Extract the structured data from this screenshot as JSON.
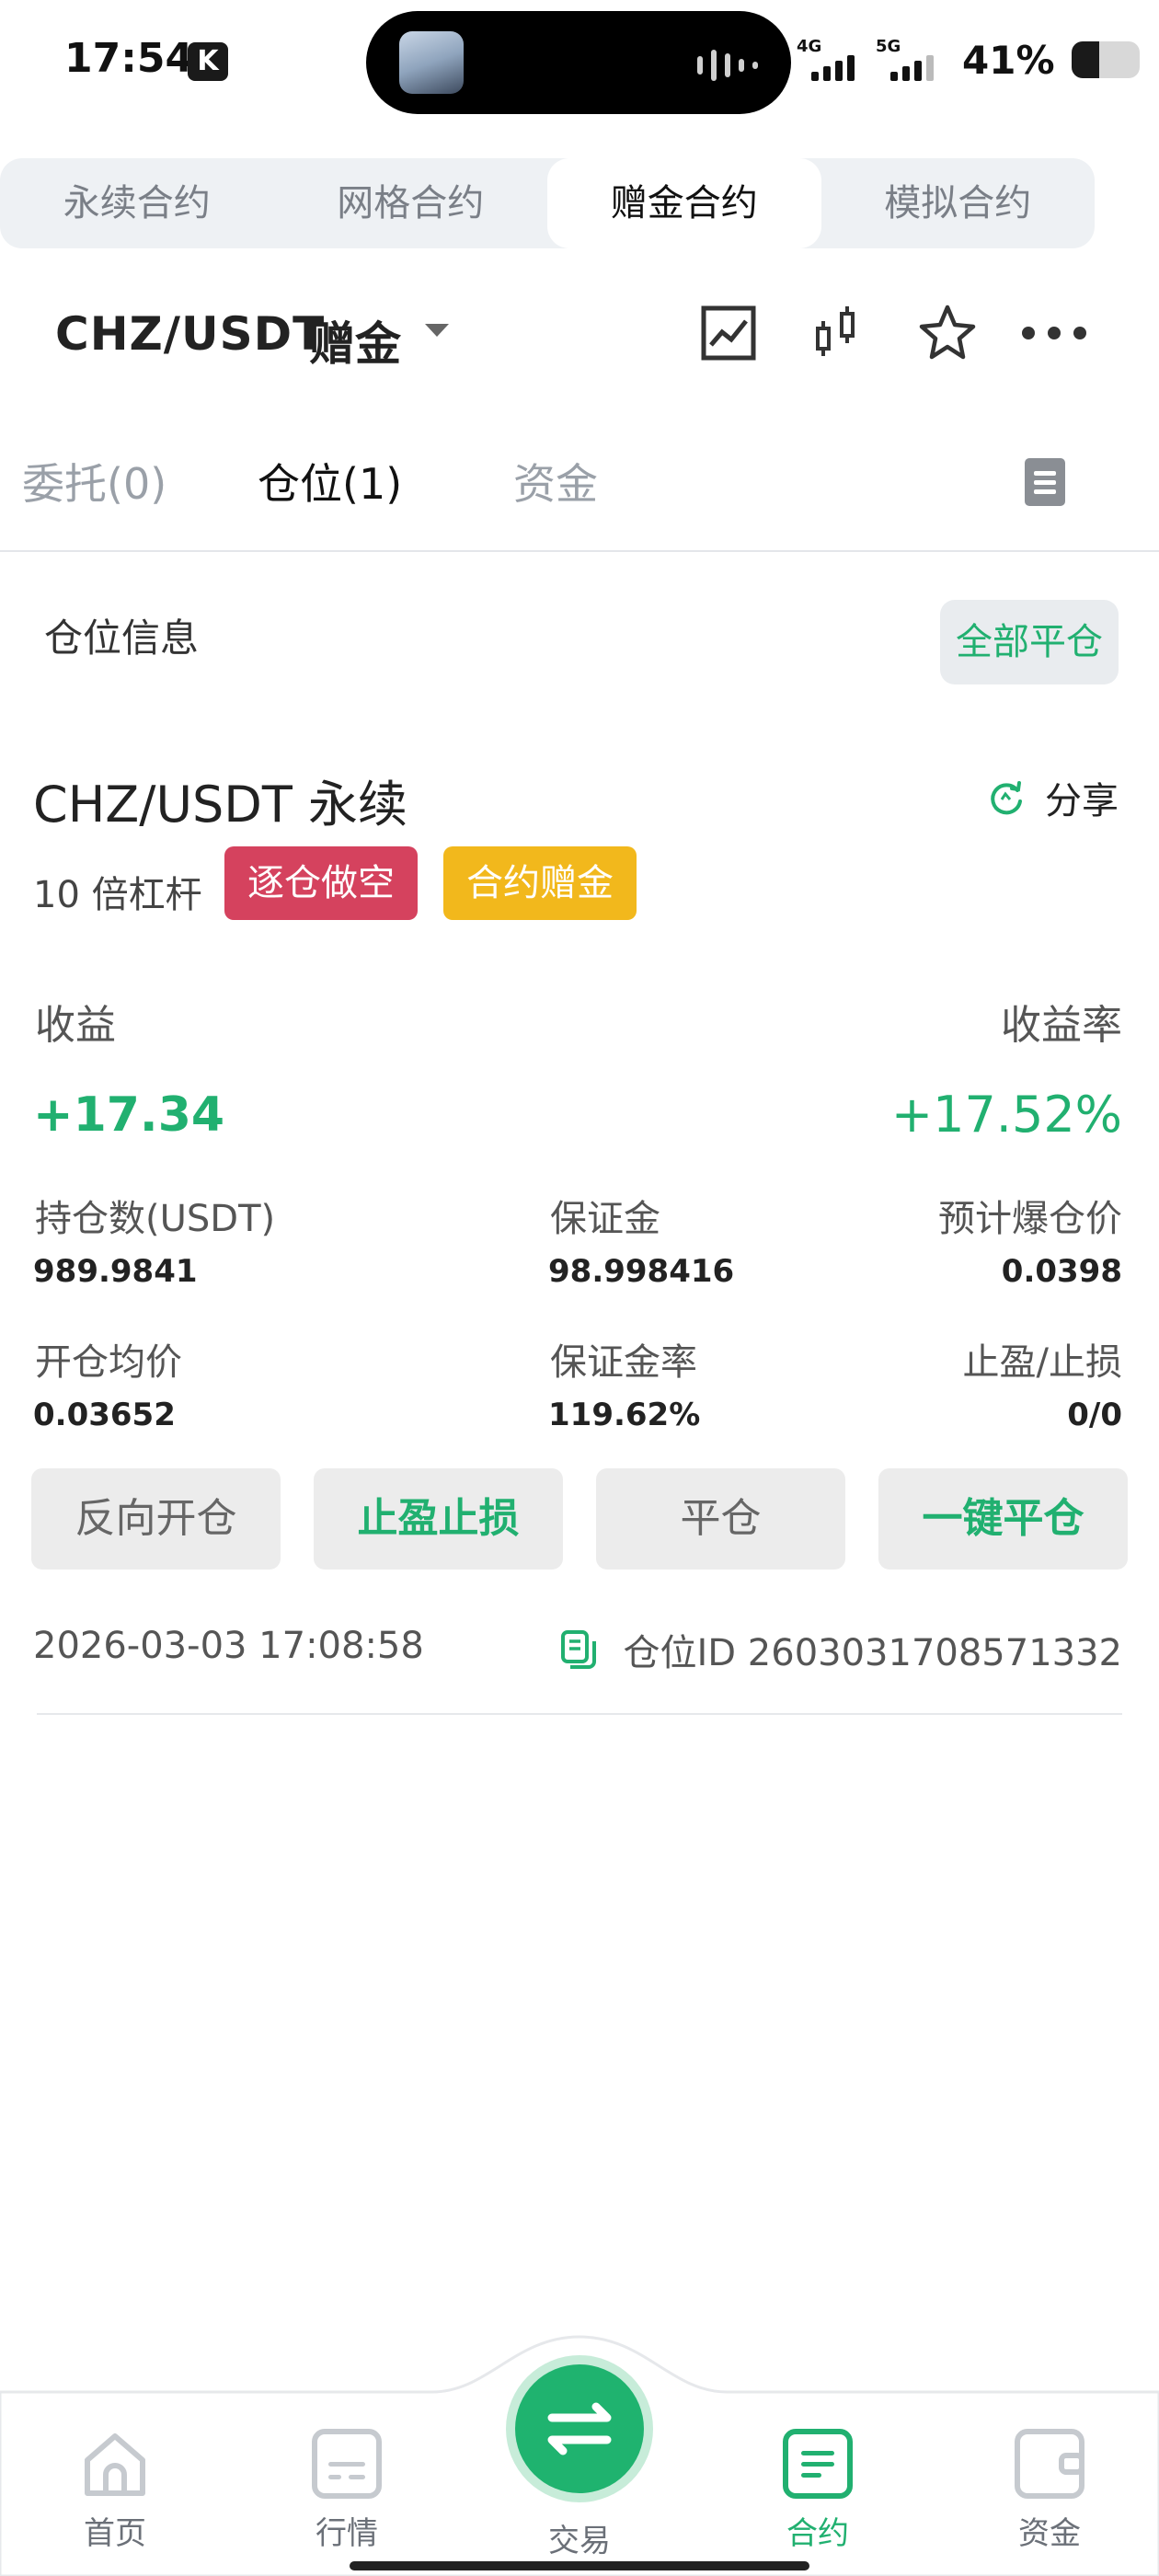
{
  "status": {
    "time": "17:54",
    "k_badge": "K",
    "net1": "4G",
    "net2": "5G",
    "battery_pct": "41%",
    "battery_level": 0.41
  },
  "type_tabs": [
    "永续合约",
    "网格合约",
    "赠金合约",
    "模拟合约"
  ],
  "symbol": {
    "pair": "CHZ/USDT",
    "tag": "赠金"
  },
  "header_icons": [
    "chart-icon",
    "candlestick-icon",
    "star-icon",
    "more-icon"
  ],
  "pos_tabs": {
    "orders": "委托(0)",
    "positions": "仓位(1)",
    "funds": "资金"
  },
  "section": {
    "title": "仓位信息",
    "close_all": "全部平仓"
  },
  "position": {
    "pair_name": "CHZ/USDT 永续",
    "share": "分享",
    "leverage": "10 倍杠杆",
    "badge_side": "逐仓做空",
    "badge_bonus": "合约赠金",
    "pnl_label": "收益",
    "pnl_rate_label": "收益率",
    "pnl": "+17.34",
    "pnl_rate": "+17.52%",
    "size_label": "持仓数(USDT)",
    "size": "989.9841",
    "margin_label": "保证金",
    "margin": "98.998416",
    "liq_label": "预计爆仓价",
    "liq": "0.0398",
    "entry_label": "开仓均价",
    "entry": "0.03652",
    "margin_rate_label": "保证金率",
    "margin_rate": "119.62%",
    "tpsl_label": "止盈/止损",
    "tpsl": "0/0",
    "actions": [
      "反向开仓",
      "止盈止损",
      "平仓",
      "一键平仓"
    ],
    "timestamp": "2026-03-03 17:08:58",
    "position_id": "仓位ID 2603031708571332"
  },
  "nav": {
    "home": "首页",
    "market": "行情",
    "trade": "交易",
    "contract": "合约",
    "assets": "资金"
  },
  "colors": {
    "green": "#21b070",
    "red_badge": "#d5425e",
    "yellow_badge": "#f2b81c"
  }
}
